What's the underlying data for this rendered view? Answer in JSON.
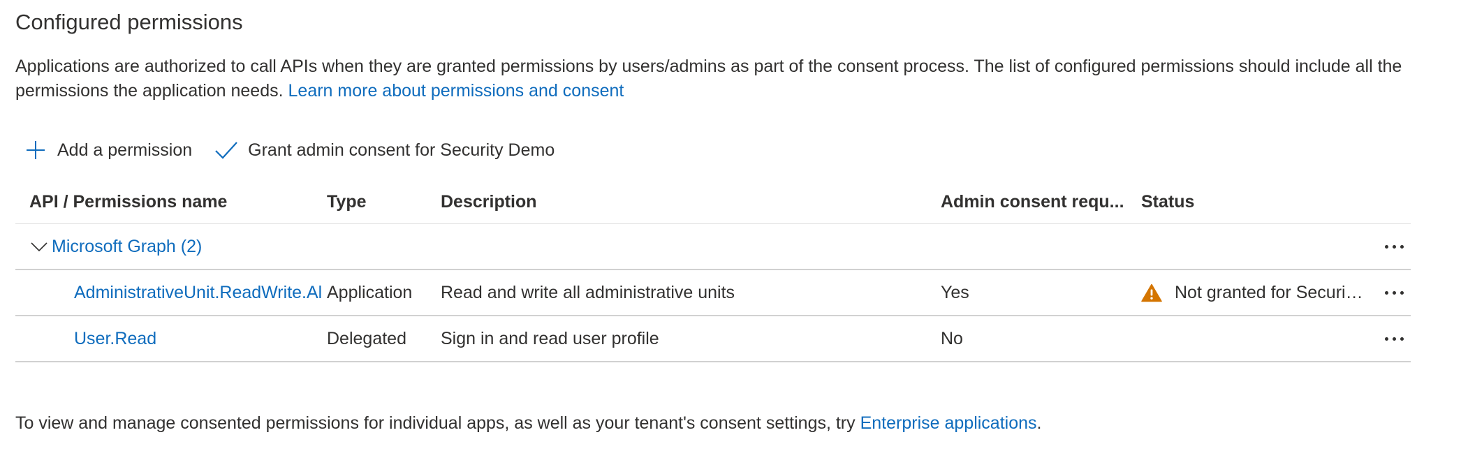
{
  "section": {
    "title": "Configured permissions",
    "intro_text": "Applications are authorized to call APIs when they are granted permissions by users/admins as part of the consent process. The list of configured permissions should include all the permissions the application needs. ",
    "intro_link": "Learn more about permissions and consent"
  },
  "toolbar": {
    "add_label": "Add a permission",
    "grant_label": "Grant admin consent for Security Demo"
  },
  "table": {
    "headers": {
      "name": "API / Permissions name",
      "type": "Type",
      "description": "Description",
      "admin": "Admin consent requ...",
      "status": "Status"
    },
    "group": {
      "label": "Microsoft Graph (2)"
    },
    "rows": [
      {
        "name": "AdministrativeUnit.ReadWrite.Al",
        "type": "Application",
        "description": "Read and write all administrative units",
        "admin": "Yes",
        "status": "Not granted for Security Demo",
        "status_icon": "warning-icon"
      },
      {
        "name": "User.Read",
        "type": "Delegated",
        "description": "Sign in and read user profile",
        "admin": "No",
        "status": ""
      }
    ]
  },
  "footer": {
    "text": "To view and manage consented permissions for individual apps, as well as your tenant's consent settings, try ",
    "link": "Enterprise applications",
    "suffix": "."
  },
  "colors": {
    "link": "#0f6cbd",
    "warning": "#d47500",
    "text": "#323130",
    "divider": "#d1d1d1"
  }
}
